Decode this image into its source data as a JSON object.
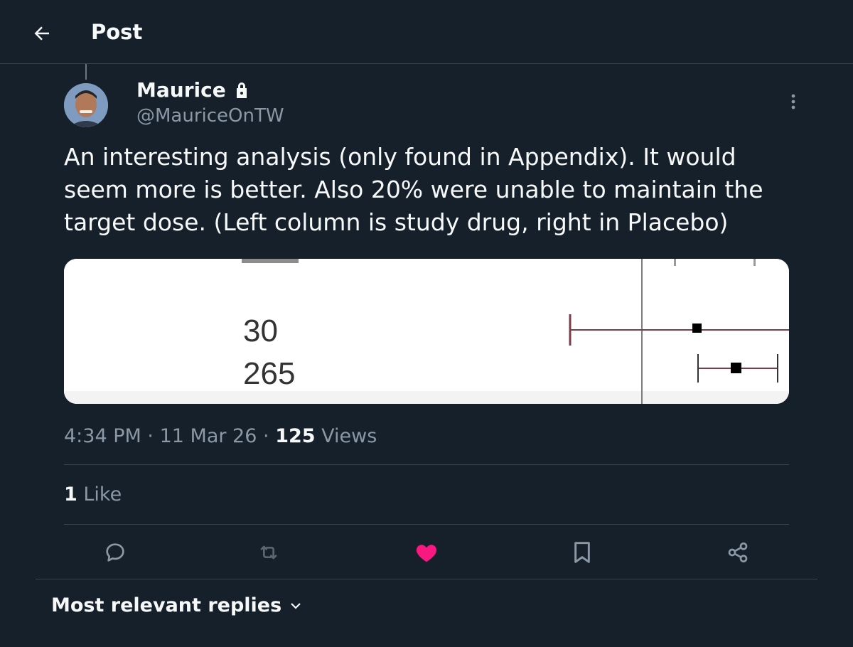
{
  "header": {
    "title": "Post",
    "back_icon": "arrow-left-icon"
  },
  "author": {
    "name": "Maurice",
    "handle": "@MauriceOnTW",
    "protected_icon": "lock-icon"
  },
  "post": {
    "text": "An interesting analysis (only found in Appendix). It would seem more is better. Also 20% were unable to maintain the target dose. (Left column is study drug, right in Placebo)",
    "image": {
      "values": [
        "30",
        "265"
      ]
    }
  },
  "meta": {
    "time": "4:34 PM",
    "date": "11 Mar 26",
    "views_count": "125",
    "views_label": "Views",
    "sep": "·"
  },
  "likes": {
    "count": "1",
    "label": "Like"
  },
  "actions": {
    "reply_icon": "reply-icon",
    "repost_icon": "repost-icon",
    "like_icon": "heart-filled-icon",
    "bookmark_icon": "bookmark-icon",
    "share_icon": "share-icon"
  },
  "replies": {
    "sort_label": "Most relevant replies",
    "chevron_icon": "chevron-down-icon"
  },
  "colors": {
    "background": "#15202b",
    "text": "#f7f9f9",
    "muted": "#8b98a5",
    "divider": "#38444d",
    "like": "#f91880",
    "plot_line": "#7a3e4a"
  }
}
